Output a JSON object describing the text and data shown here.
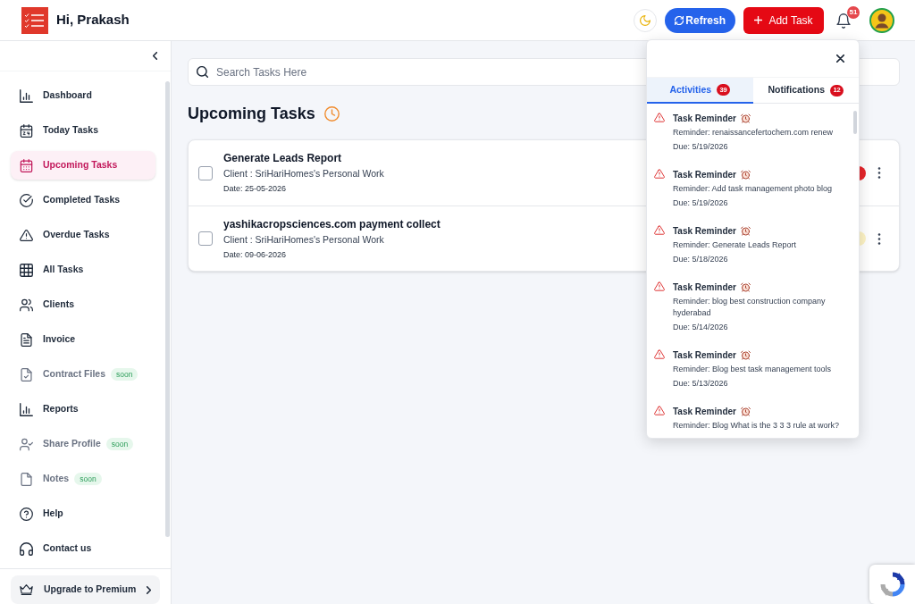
{
  "header": {
    "greeting": "Hi, Prakash",
    "buttons": [
      {
        "label": "Refresh",
        "kind": "refresh"
      },
      {
        "label": "Add Task",
        "kind": "add"
      }
    ],
    "notification_count": "51"
  },
  "sidebar": {
    "items": [
      {
        "label": "Dashboard",
        "selected": false,
        "disabled": false
      },
      {
        "label": "Today Tasks",
        "selected": false,
        "disabled": false
      },
      {
        "label": "Upcoming Tasks",
        "selected": true,
        "disabled": false
      },
      {
        "label": "Completed Tasks",
        "selected": false,
        "disabled": false
      },
      {
        "label": "Overdue Tasks",
        "selected": false,
        "disabled": false
      },
      {
        "label": "All Tasks",
        "selected": false,
        "disabled": false
      },
      {
        "label": "Clients",
        "selected": false,
        "disabled": false
      },
      {
        "label": "Invoice",
        "selected": false,
        "disabled": false
      },
      {
        "label": "Contract Files",
        "selected": false,
        "disabled": true,
        "badge": "soon"
      },
      {
        "label": "Reports",
        "selected": false,
        "disabled": false
      },
      {
        "label": "Share Profile",
        "selected": false,
        "disabled": true,
        "badge": "soon"
      },
      {
        "label": "Notes",
        "selected": false,
        "disabled": true,
        "badge": "soon"
      },
      {
        "label": "Help",
        "selected": false,
        "disabled": false
      },
      {
        "label": "Contact us",
        "selected": false,
        "disabled": false
      }
    ],
    "upgrade": {
      "label": "Upgrade to Premium"
    }
  },
  "search": {
    "placeholder": "Search Tasks Here"
  },
  "page_title": "Upcoming Tasks",
  "tasks": [
    {
      "title": "Generate Leads Report",
      "client": "Client : SriHariHomes's Personal Work",
      "date": "Date: 25-05-2026",
      "checked": false,
      "color": "#e5252a"
    },
    {
      "title": "yashikacropsciences.com payment collect",
      "client": "Client : SriHariHomes's Personal Work",
      "date": "Date: 09-06-2026",
      "checked": false,
      "color": "#fdf3c4"
    }
  ],
  "popup": {
    "tabs": [
      {
        "label": "Activities",
        "count": "39",
        "selected": true
      },
      {
        "label": "Notifications",
        "count": "12",
        "selected": false
      }
    ],
    "items": [
      {
        "title": "Task Reminder",
        "text": "Reminder: renaissancefertochem.com renew",
        "due": "Due: 5/19/2026"
      },
      {
        "title": "Task Reminder",
        "text": "Reminder: Add task management photo blog",
        "due": "Due: 5/19/2026"
      },
      {
        "title": "Task Reminder",
        "text": "Reminder: Generate Leads Report",
        "due": "Due: 5/18/2026"
      },
      {
        "title": "Task Reminder",
        "text": "Reminder: blog best construction company hyderabad",
        "due": "Due: 5/14/2026"
      },
      {
        "title": "Task Reminder",
        "text": "Reminder: Blog best task management tools",
        "due": "Due: 5/13/2026"
      },
      {
        "title": "Task Reminder",
        "text": "Reminder: Blog What is the 3 3 3 rule at work?"
      }
    ]
  }
}
